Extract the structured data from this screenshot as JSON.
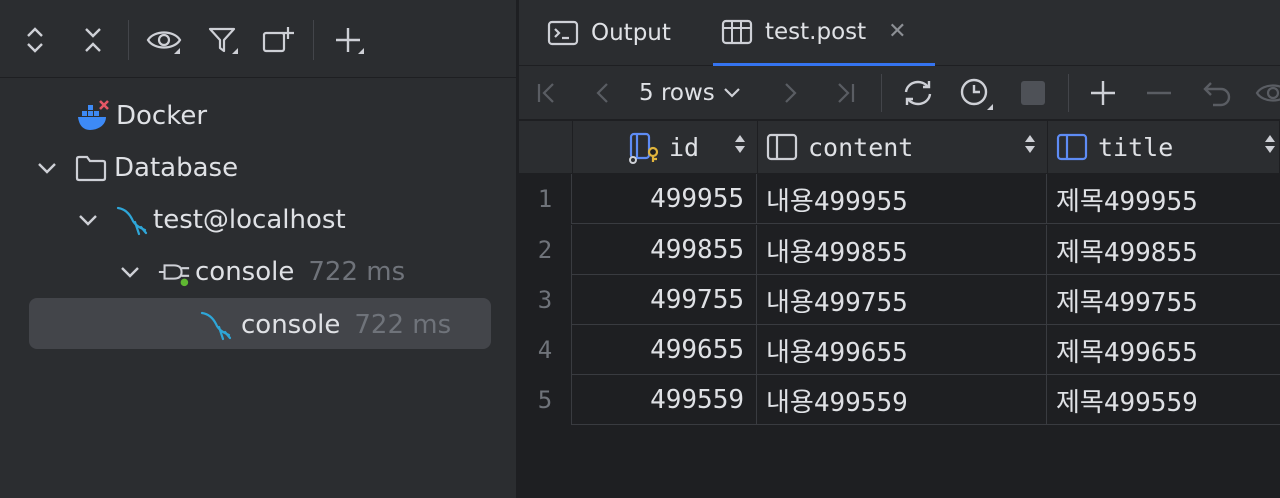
{
  "left_toolbar": {
    "buttons": [
      "expand-all",
      "collapse-all",
      "view-options",
      "filter",
      "new-tab",
      "add"
    ]
  },
  "tree": {
    "docker": {
      "label": "Docker"
    },
    "database": {
      "label": "Database"
    },
    "connection": {
      "label": "test@localhost"
    },
    "session": {
      "label": "console",
      "time": "722 ms"
    },
    "console": {
      "label": "console",
      "time": "722 ms"
    }
  },
  "tabs": [
    {
      "label": "Output",
      "icon": "console-output-icon"
    },
    {
      "label": "test.post",
      "icon": "table-icon",
      "active": true
    }
  ],
  "grid_toolbar": {
    "rows_label": "5 rows"
  },
  "table": {
    "columns": [
      {
        "name": "id",
        "icon": "primary-key-column-icon"
      },
      {
        "name": "content",
        "icon": "column-icon"
      },
      {
        "name": "title",
        "icon": "column-icon"
      }
    ],
    "rows": [
      {
        "num": "1",
        "id": "499955",
        "content": "내용499955",
        "title": "제목499955"
      },
      {
        "num": "2",
        "id": "499855",
        "content": "내용499855",
        "title": "제목499855"
      },
      {
        "num": "3",
        "id": "499755",
        "content": "내용499755",
        "title": "제목499755"
      },
      {
        "num": "4",
        "id": "499655",
        "content": "내용499655",
        "title": "제목499655"
      },
      {
        "num": "5",
        "id": "499559",
        "content": "내용499559",
        "title": "제목499559"
      }
    ]
  },
  "colors": {
    "accent": "#3574f0",
    "mysql": "#2ea6d8",
    "docker": "#3d8af7",
    "error": "#e55765",
    "connected": "#5fb832"
  }
}
